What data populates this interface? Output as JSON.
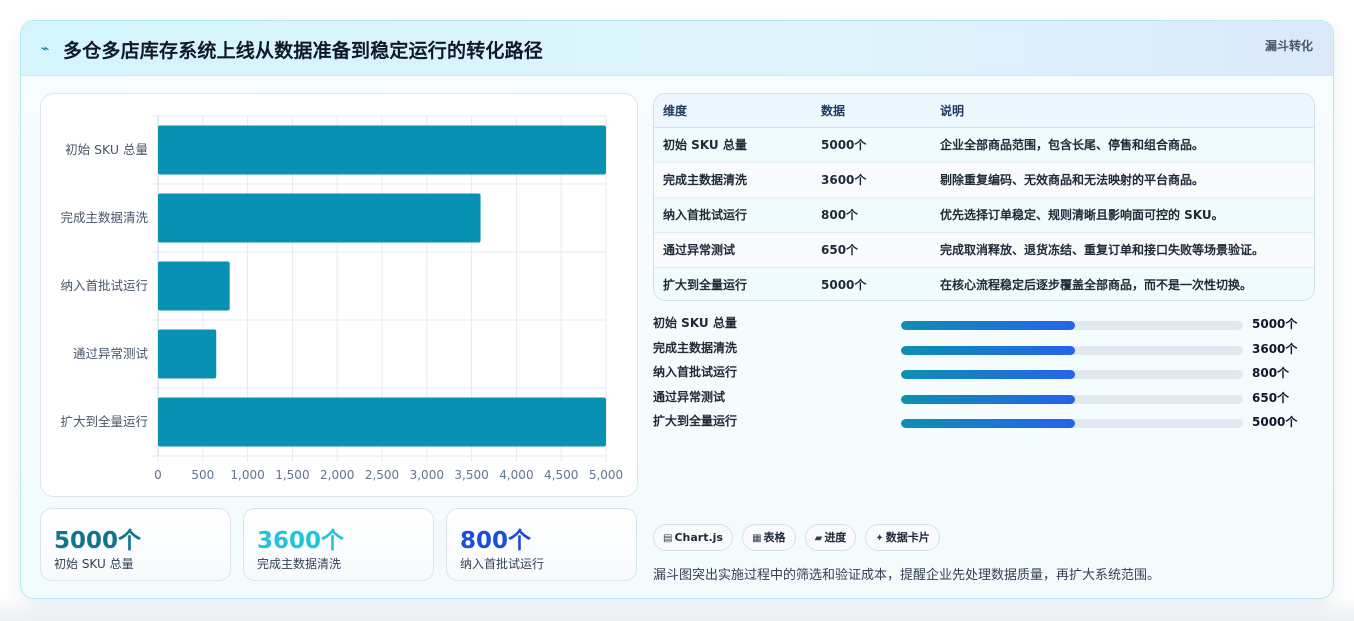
{
  "header": {
    "icon": "trend-line-icon",
    "title": "多仓多店库存系统上线从数据准备到稳定运行的转化路径",
    "tag": "漏斗转化"
  },
  "chart_data": {
    "type": "bar",
    "orientation": "horizontal",
    "categories": [
      "初始 SKU 总量",
      "完成主数据清洗",
      "纳入首批试运行",
      "通过异常测试",
      "扩大到全量运行"
    ],
    "values": [
      5000,
      3600,
      800,
      650,
      5000
    ],
    "xlim": [
      0,
      5000
    ],
    "xticks": [
      0,
      500,
      1000,
      1500,
      2000,
      2500,
      3000,
      3500,
      4000,
      4500,
      5000
    ],
    "xtick_labels": [
      "0",
      "500",
      "1,000",
      "1,500",
      "2,000",
      "2,500",
      "3,000",
      "3,500",
      "4,000",
      "4,500",
      "5,000"
    ],
    "grid": true,
    "legend": "none",
    "bar_color": "#0891b2"
  },
  "stats": [
    {
      "value": "5000个",
      "label": "初始 SKU 总量",
      "color": "#0e7490"
    },
    {
      "value": "3600个",
      "label": "完成主数据清洗",
      "color": "#22c3dd"
    },
    {
      "value": "800个",
      "label": "纳入首批试运行",
      "color": "#1d4ed8"
    }
  ],
  "table": {
    "headers": [
      "维度",
      "数据",
      "说明"
    ],
    "rows": [
      {
        "name": "初始 SKU 总量",
        "value": "5000个",
        "desc": "企业全部商品范围，包含长尾、停售和组合商品。"
      },
      {
        "name": "完成主数据清洗",
        "value": "3600个",
        "desc": "剔除重复编码、无效商品和无法映射的平台商品。"
      },
      {
        "name": "纳入首批试运行",
        "value": "800个",
        "desc": "优先选择订单稳定、规则清晰且影响面可控的 SKU。"
      },
      {
        "name": "通过异常测试",
        "value": "650个",
        "desc": "完成取消释放、退货冻结、重复订单和接口失败等场景验证。"
      },
      {
        "name": "扩大到全量运行",
        "value": "5000个",
        "desc": "在核心流程稳定后逐步覆盖全部商品，而不是一次性切换。"
      }
    ]
  },
  "progress": [
    {
      "label": "初始 SKU 总量",
      "value": "5000个",
      "fill": 0.51
    },
    {
      "label": "完成主数据清洗",
      "value": "3600个",
      "fill": 0.51
    },
    {
      "label": "纳入首批试运行",
      "value": "800个",
      "fill": 0.51
    },
    {
      "label": "通过异常测试",
      "value": "650个",
      "fill": 0.51
    },
    {
      "label": "扩大到全量运行",
      "value": "5000个",
      "fill": 0.51
    }
  ],
  "chips": [
    {
      "icon": "chart-icon",
      "glyph": "▤",
      "label": "Chart.js"
    },
    {
      "icon": "table-icon",
      "glyph": "▦",
      "label": "表格"
    },
    {
      "icon": "progress-icon",
      "glyph": "▰",
      "label": "进度"
    },
    {
      "icon": "sparkle-icon",
      "glyph": "✦",
      "label": "数据卡片"
    }
  ],
  "footnote": "漏斗图突出实施过程中的筛选和验证成本，提醒企业先处理数据质量，再扩大系统范围。"
}
